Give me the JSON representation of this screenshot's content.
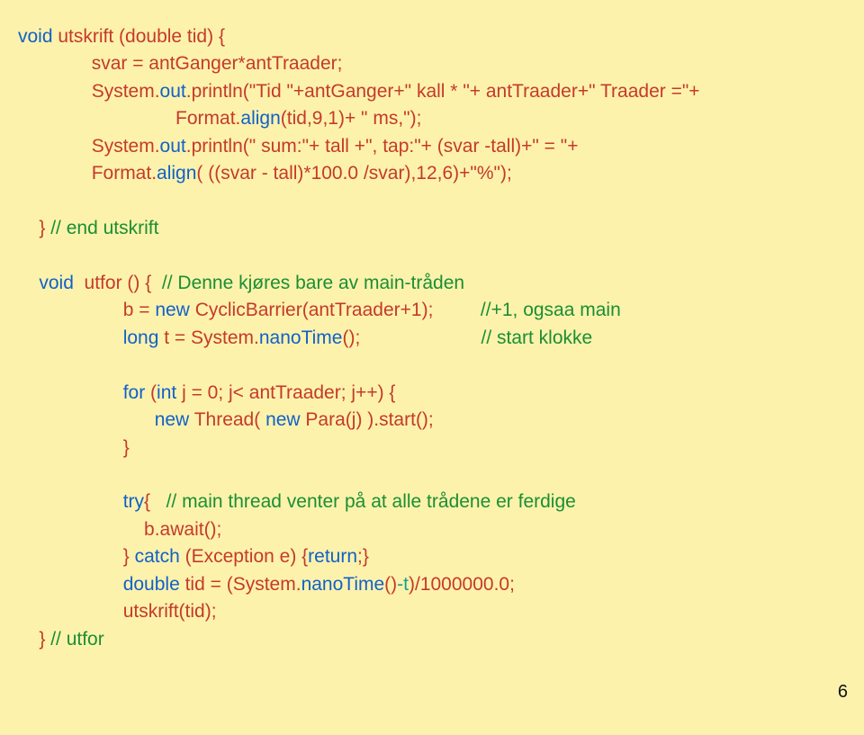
{
  "lines": [
    {
      "indent": 0,
      "runs": [
        {
          "c": "blue",
          "t": "void"
        },
        {
          "c": "red",
          "t": " utskrift (double tid) {"
        }
      ]
    },
    {
      "indent": 14,
      "runs": [
        {
          "c": "red",
          "t": "svar = antGanger*antTraader;"
        }
      ]
    },
    {
      "indent": 14,
      "runs": [
        {
          "c": "red",
          "t": "System."
        },
        {
          "c": "blue",
          "t": "out"
        },
        {
          "c": "red",
          "t": ".println(\"Tid \"+antGanger+\" kall * \"+ antTraader+\" Traader =\"+"
        }
      ]
    },
    {
      "indent": 30,
      "runs": [
        {
          "c": "red",
          "t": "Format."
        },
        {
          "c": "blue",
          "t": "align"
        },
        {
          "c": "red",
          "t": "(tid,9,1)+ \" ms,\");"
        }
      ]
    },
    {
      "indent": 14,
      "runs": [
        {
          "c": "red",
          "t": "System."
        },
        {
          "c": "blue",
          "t": "out"
        },
        {
          "c": "red",
          "t": ".println(\" sum:\"+ tall +\", tap:\"+ (svar -tall)+\" = \"+"
        }
      ]
    },
    {
      "indent": 14,
      "runs": [
        {
          "c": "red",
          "t": "Format."
        },
        {
          "c": "blue",
          "t": "align"
        },
        {
          "c": "red",
          "t": "( ((svar - tall)*100.0 /svar),12,6)+\"%\");"
        }
      ]
    },
    {
      "indent": 0,
      "runs": [
        {
          "c": "red",
          "t": " "
        }
      ]
    },
    {
      "indent": 4,
      "runs": [
        {
          "c": "red",
          "t": "} "
        },
        {
          "c": "green",
          "t": "// end utskrift"
        }
      ]
    },
    {
      "indent": 0,
      "runs": [
        {
          "c": "red",
          "t": " "
        }
      ]
    },
    {
      "indent": 4,
      "runs": [
        {
          "c": "blue",
          "t": "void"
        },
        {
          "c": "red",
          "t": "  utfor () {  "
        },
        {
          "c": "green",
          "t": "// Denne kjøres bare av main-tråden"
        }
      ]
    },
    {
      "indent": 20,
      "runs": [
        {
          "c": "red",
          "t": "b = "
        },
        {
          "c": "blue",
          "t": "new"
        },
        {
          "c": "red",
          "t": " CyclicBarrier(antTraader+1);         "
        },
        {
          "c": "green",
          "t": "//+1, ogsaa main"
        }
      ]
    },
    {
      "indent": 20,
      "runs": [
        {
          "c": "blue",
          "t": "long"
        },
        {
          "c": "red",
          "t": " t = System."
        },
        {
          "c": "blue",
          "t": "nanoTime"
        },
        {
          "c": "red",
          "t": "();                       "
        },
        {
          "c": "green",
          "t": "// start klokke"
        }
      ]
    },
    {
      "indent": 0,
      "runs": [
        {
          "c": "red",
          "t": " "
        }
      ]
    },
    {
      "indent": 20,
      "runs": [
        {
          "c": "blue",
          "t": "for"
        },
        {
          "c": "red",
          "t": " ("
        },
        {
          "c": "blue",
          "t": "int"
        },
        {
          "c": "red",
          "t": " j = 0; j< antTraader; j++) {"
        }
      ]
    },
    {
      "indent": 26,
      "runs": [
        {
          "c": "blue",
          "t": "new"
        },
        {
          "c": "red",
          "t": " Thread( "
        },
        {
          "c": "blue",
          "t": "new"
        },
        {
          "c": "red",
          "t": " Para(j) ).start();"
        }
      ]
    },
    {
      "indent": 20,
      "runs": [
        {
          "c": "red",
          "t": "}"
        }
      ]
    },
    {
      "indent": 0,
      "runs": [
        {
          "c": "red",
          "t": " "
        }
      ]
    },
    {
      "indent": 20,
      "runs": [
        {
          "c": "blue",
          "t": "try"
        },
        {
          "c": "red",
          "t": "{   "
        },
        {
          "c": "green",
          "t": "// main thread venter på at alle trådene er ferdige"
        }
      ]
    },
    {
      "indent": 24,
      "runs": [
        {
          "c": "red",
          "t": "b.await();"
        }
      ]
    },
    {
      "indent": 20,
      "runs": [
        {
          "c": "red",
          "t": "} "
        },
        {
          "c": "blue",
          "t": "catch"
        },
        {
          "c": "red",
          "t": " (Exception e) {"
        },
        {
          "c": "blue",
          "t": "return"
        },
        {
          "c": "red",
          "t": ";}"
        }
      ]
    },
    {
      "indent": 20,
      "runs": [
        {
          "c": "blue",
          "t": "double"
        },
        {
          "c": "red",
          "t": " tid = (System."
        },
        {
          "c": "blue",
          "t": "nanoTime"
        },
        {
          "c": "red",
          "t": "()"
        },
        {
          "c": "teal",
          "t": "-t"
        },
        {
          "c": "red",
          "t": ")/1000000.0;"
        }
      ]
    },
    {
      "indent": 20,
      "runs": [
        {
          "c": "red",
          "t": "utskrift(tid);"
        }
      ]
    },
    {
      "indent": 4,
      "runs": [
        {
          "c": "red",
          "t": "} "
        },
        {
          "c": "green",
          "t": "// utfor"
        }
      ]
    }
  ],
  "pagenum": "6"
}
